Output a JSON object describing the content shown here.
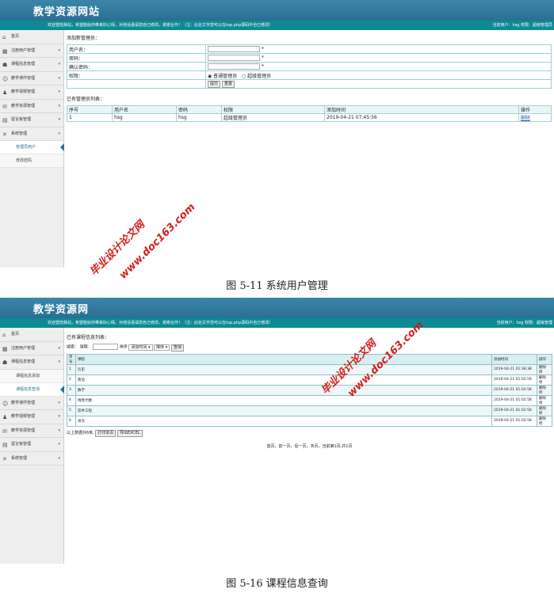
{
  "figures": {
    "fig1": {
      "site_title": "教学资源网站",
      "welcome_msg": "欢迎登陆我站，希望能给你带来好心情，对他话语请您自己修改，谢谢合作！（注：此处文字您可以在top.php源码中自己修改）",
      "user_info": "当前用户：hsg 权限：超级管理员",
      "nav": [
        {
          "label": "首页",
          "icon": "home-icon"
        },
        {
          "label": "注册用户管理",
          "icon": "grid-icon"
        },
        {
          "label": "课程信息管理",
          "icon": "book-icon"
        },
        {
          "label": "教学课件管理",
          "icon": "users-icon"
        },
        {
          "label": "教学视频管理",
          "icon": "user-icon"
        },
        {
          "label": "教学资源管理",
          "icon": "chat-icon"
        },
        {
          "label": "留言板管理",
          "icon": "message-icon"
        },
        {
          "label": "系统管理",
          "icon": "tools-icon"
        }
      ],
      "sub_nav": [
        "管理员用户",
        "修改密码"
      ],
      "add_title": "添加新管理员：",
      "form": {
        "username_label": "用户名：",
        "password_label": "密码：",
        "confirm_label": "确认密码：",
        "perm_label": "权限：",
        "required_mark": "*",
        "perm_options": [
          "普通管理员",
          "超级管理员"
        ],
        "submit": "提交",
        "reset": "重置"
      },
      "list_title": "已有管理员列表：",
      "list_headers": [
        "序号",
        "用户名",
        "密码",
        "权限",
        "添加时间",
        "操作"
      ],
      "list_rows": [
        [
          "1",
          "hsg",
          "hsg",
          "超级管理员",
          "2019-04-21 07:45:56",
          "删除"
        ]
      ],
      "caption": "图 5-11 系统用户管理"
    },
    "fig2": {
      "site_title": "教学资源网",
      "welcome_msg": "欢迎登陆我站，希望能给你带来好心情，对他话语请您自己修改，谢谢合作！（注：此处文字您可以在top.php源码中自己修改）",
      "user_info": "当前用户：hsg 权限：超级管理",
      "nav_top": [
        {
          "label": "首页",
          "icon": "home-icon"
        },
        {
          "label": "注册用户管理",
          "icon": "grid-icon"
        },
        {
          "label": "课程信息管理",
          "icon": "book-icon"
        }
      ],
      "sub_nav": [
        "课程信息添加",
        "课程信息查询"
      ],
      "nav_bottom": [
        {
          "label": "教学课件管理",
          "icon": "users-icon"
        },
        {
          "label": "教学视频管理",
          "icon": "user-icon"
        },
        {
          "label": "教学资源管理",
          "icon": "chat-icon"
        },
        {
          "label": "留言板管理",
          "icon": "message-icon"
        },
        {
          "label": "系统管理",
          "icon": "tools-icon"
        }
      ],
      "list_title": "已有课程信息列表：",
      "search": {
        "label": "搜索：",
        "field_label": "课程：",
        "sort_label": "排序",
        "sort_field": "添加时间",
        "sort_order": "降序",
        "query_btn": "查询"
      },
      "headers": [
        "序号",
        "课程",
        "添加时间",
        "操作"
      ],
      "rows": [
        [
          "1",
          "历史",
          "2019-04-21 01:38:38",
          "删除 修"
        ],
        [
          "2",
          "政治",
          "2019-04-21 01:02:59",
          "删除 修"
        ],
        [
          "3",
          "数学",
          "2019-04-21 01:02:58",
          "删除 修"
        ],
        [
          "4",
          "线性代数",
          "2019-04-21 01:02:58",
          "删除 修"
        ],
        [
          "5",
          "软件工程",
          "2019-04-21 01:02:58",
          "删除 修"
        ],
        [
          "6",
          "语文",
          "2019-04-21 01:02:58",
          "删除 修"
        ]
      ],
      "total_text": "以上数据共6条,",
      "print_btn": "打印本页",
      "excel_btn": "导出EXCEL",
      "pager": "首页，前一页，后一页，末页，当前第1页,共1页",
      "caption": "图 5-16 课程信息查询"
    }
  },
  "watermark": {
    "site": "毕业设计论文网",
    "url": "www.doc163.com",
    "color": "#d2140f"
  }
}
